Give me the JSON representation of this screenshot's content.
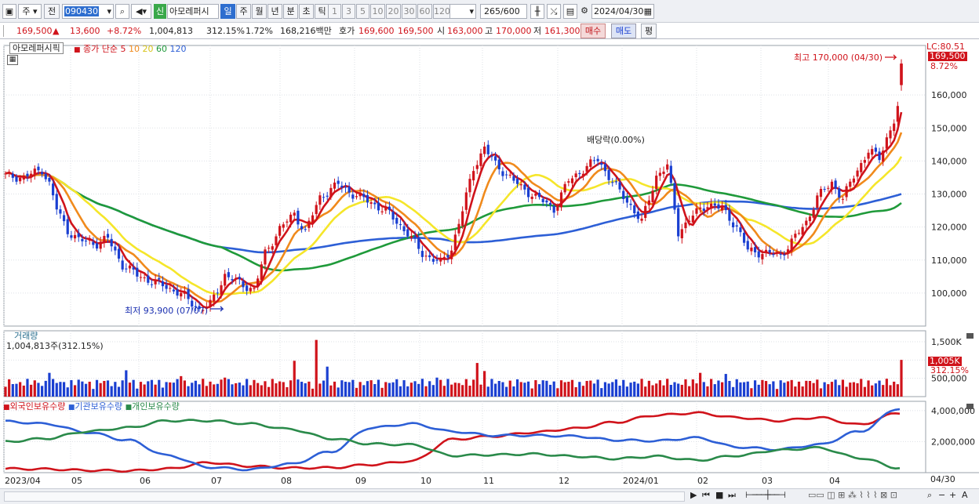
{
  "toolbar": {
    "period": "주",
    "prev": "전",
    "code": "090430",
    "new_badge": "신",
    "stock_name": "아모레퍼시",
    "periods": [
      "일",
      "주",
      "월",
      "년",
      "분",
      "초",
      "틱"
    ],
    "active_period": "일",
    "intervals": [
      "1",
      "3",
      "5",
      "10",
      "20",
      "30",
      "60",
      "120"
    ],
    "count": "265",
    "count_total": "/600",
    "date": "2024/04/30"
  },
  "quote": {
    "price": "169,500",
    "arrow": "▲",
    "change": "13,600",
    "change_pct": "+8.72%",
    "volume": "1,004,813",
    "volume_ratio": "312.15%",
    "turnover": "1.72%",
    "amount": "168,216백만",
    "hoga_label": "호가",
    "ask": "169,600",
    "bid": "169,500",
    "open_label": "시",
    "open": "163,000",
    "high_label": "고",
    "high": "170,000",
    "low_label": "저",
    "low": "161,300",
    "buy_btn": "매수",
    "sell_btn": "매도",
    "eval_btn": "평"
  },
  "panes": {
    "price_title": "아모레퍼시픽",
    "ma_label": "종가 단순",
    "lc_label": "LC:80.51",
    "price_tag": "169,500",
    "pct_tag": "8.72%",
    "high_note": "최고 170,000 (04/30)",
    "low_note": "최저 93,900 (07/07)",
    "div_note": "배당락(0.00%)",
    "volume_title": "거래량",
    "volume_value": "1,004,813주(312.15%)",
    "volume_tag": "1,005K",
    "volume_pct_tag": "312.15%",
    "holdings_title_1": "외국인보유수량",
    "holdings_title_2": "기관보유수량",
    "holdings_title_3": "개인보유수량",
    "last_date": "04/30"
  },
  "colors": {
    "up": "#d0131b",
    "down": "#1a3fd1",
    "ma5": "#d0131b",
    "ma10": "#f08a1c",
    "ma20": "#f5e62a",
    "ma60": "#1f9a3a",
    "ma120": "#2d5fd6",
    "foreign": "#d0131b",
    "institution": "#2d5fd6",
    "individual": "#2a8a4a"
  },
  "chart_data": [
    {
      "type": "candlestick",
      "title": "아모레퍼시픽",
      "ylabel": "",
      "ylim": [
        90000,
        175000
      ],
      "yticks": [
        "100,000",
        "110,000",
        "120,000",
        "130,000",
        "140,000",
        "150,000",
        "160,000"
      ],
      "x_ticks": [
        "2023/04",
        "05",
        "06",
        "07",
        "08",
        "09",
        "10",
        "11",
        "12",
        "2024/01",
        "02",
        "03",
        "04"
      ],
      "moving_averages": [
        {
          "name": "5",
          "color": "#d0131b"
        },
        {
          "name": "10",
          "color": "#f08a1c"
        },
        {
          "name": "20",
          "color": "#f5e62a"
        },
        {
          "name": "60",
          "color": "#1f9a3a"
        },
        {
          "name": "120",
          "color": "#2d5fd6"
        }
      ],
      "close_path": [
        {
          "x": 0,
          "y": 135500
        },
        {
          "x": 5,
          "y": 135000
        },
        {
          "x": 10,
          "y": 137500
        },
        {
          "x": 12,
          "y": 133000
        },
        {
          "x": 14,
          "y": 125500
        },
        {
          "x": 17,
          "y": 119000
        },
        {
          "x": 20,
          "y": 116000
        },
        {
          "x": 25,
          "y": 115000
        },
        {
          "x": 28,
          "y": 116500
        },
        {
          "x": 32,
          "y": 108500
        },
        {
          "x": 36,
          "y": 105500
        },
        {
          "x": 40,
          "y": 103500
        },
        {
          "x": 44,
          "y": 102000
        },
        {
          "x": 49,
          "y": 99000
        },
        {
          "x": 53,
          "y": 95000
        },
        {
          "x": 56,
          "y": 96500
        },
        {
          "x": 60,
          "y": 105500
        },
        {
          "x": 64,
          "y": 103000
        },
        {
          "x": 68,
          "y": 101000
        },
        {
          "x": 71,
          "y": 112000
        },
        {
          "x": 75,
          "y": 119500
        },
        {
          "x": 79,
          "y": 124000
        },
        {
          "x": 82,
          "y": 118500
        },
        {
          "x": 86,
          "y": 129000
        },
        {
          "x": 91,
          "y": 133000
        },
        {
          "x": 95,
          "y": 130000
        },
        {
          "x": 100,
          "y": 127500
        },
        {
          "x": 105,
          "y": 124000
        },
        {
          "x": 110,
          "y": 118000
        },
        {
          "x": 114,
          "y": 112000
        },
        {
          "x": 119,
          "y": 109000
        },
        {
          "x": 122,
          "y": 113500
        },
        {
          "x": 125,
          "y": 125000
        },
        {
          "x": 128,
          "y": 138000
        },
        {
          "x": 131,
          "y": 144000
        },
        {
          "x": 134,
          "y": 139000
        },
        {
          "x": 137,
          "y": 136000
        },
        {
          "x": 141,
          "y": 132000
        },
        {
          "x": 146,
          "y": 128500
        },
        {
          "x": 150,
          "y": 125500
        },
        {
          "x": 154,
          "y": 134000
        },
        {
          "x": 158,
          "y": 137500
        },
        {
          "x": 162,
          "y": 140500
        },
        {
          "x": 164,
          "y": 137000
        },
        {
          "x": 168,
          "y": 130500
        },
        {
          "x": 171,
          "y": 126500
        },
        {
          "x": 174,
          "y": 121500
        },
        {
          "x": 178,
          "y": 135500
        },
        {
          "x": 181,
          "y": 138500
        },
        {
          "x": 184,
          "y": 118500
        },
        {
          "x": 188,
          "y": 123500
        },
        {
          "x": 192,
          "y": 127000
        },
        {
          "x": 196,
          "y": 125500
        },
        {
          "x": 200,
          "y": 120000
        },
        {
          "x": 203,
          "y": 113000
        },
        {
          "x": 208,
          "y": 112000
        },
        {
          "x": 212,
          "y": 111500
        },
        {
          "x": 215,
          "y": 115500
        },
        {
          "x": 219,
          "y": 121500
        },
        {
          "x": 222,
          "y": 129000
        },
        {
          "x": 226,
          "y": 133500
        },
        {
          "x": 229,
          "y": 128500
        },
        {
          "x": 232,
          "y": 135500
        },
        {
          "x": 236,
          "y": 143000
        },
        {
          "x": 239,
          "y": 141000
        },
        {
          "x": 241,
          "y": 147000
        },
        {
          "x": 243,
          "y": 152000
        },
        {
          "x": 244,
          "y": 155900
        },
        {
          "x": 245,
          "y": 169500
        }
      ],
      "annotations": [
        "최고 170,000 (04/30)",
        "최저 93,900 (07/07)",
        "배당락(0.00%)"
      ]
    },
    {
      "type": "bar",
      "title": "거래량",
      "ylim": [
        0,
        1800000
      ],
      "yticks": [
        "500,000",
        "1,000K",
        "1,500K"
      ],
      "last_value": 1004813
    },
    {
      "type": "line",
      "title": "보유수량",
      "ylim": [
        0,
        4600000
      ],
      "yticks": [
        "2,000,000",
        "4,000,000"
      ],
      "series": [
        {
          "name": "외국인보유수량",
          "values": [
            250000,
            230000,
            150000,
            120000,
            250000,
            650000,
            420000,
            300000,
            320000,
            520000,
            750000,
            2150000,
            2350000,
            2600000,
            2850000,
            3250000,
            3700000,
            3850000,
            3550000,
            3350000,
            3550000,
            3100000,
            3850000
          ]
        },
        {
          "name": "기관보유수량",
          "values": [
            3300000,
            3150000,
            2600000,
            2100000,
            1100000,
            350000,
            200000,
            550000,
            1350000,
            2900000,
            3150000,
            2650000,
            2400000,
            2400000,
            2350000,
            2100000,
            2050000,
            2250000,
            1650000,
            1500000,
            1800000,
            2650000,
            4150000
          ]
        },
        {
          "name": "개인보유수량",
          "values": [
            2000000,
            2200000,
            2650000,
            2900000,
            3350000,
            3350000,
            3150000,
            2800000,
            2200000,
            1850000,
            1800000,
            1100000,
            1150000,
            1200000,
            1050000,
            900000,
            1050000,
            800000,
            1100000,
            1450000,
            1600000,
            950000,
            300000
          ]
        }
      ]
    }
  ]
}
